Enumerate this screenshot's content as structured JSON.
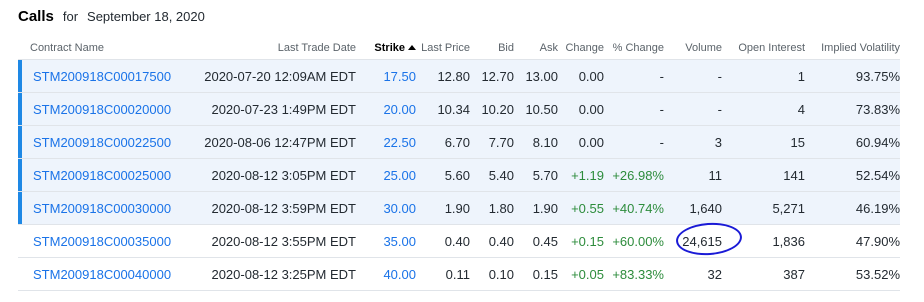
{
  "header": {
    "title": "Calls",
    "for_label": "for",
    "date": "September 18, 2020"
  },
  "columns": [
    "Contract Name",
    "Last Trade Date",
    "Strike",
    "Last Price",
    "Bid",
    "Ask",
    "Change",
    "% Change",
    "Volume",
    "Open Interest",
    "Implied Volatility"
  ],
  "sort": {
    "column": "Strike",
    "direction": "ascending"
  },
  "colors": {
    "link": "#1a73e8",
    "in_the_money_bg": "#eef4fc",
    "in_the_money_marker": "#1e88e5",
    "positive": "#2d8c3c",
    "annotation": "#1a1ad6"
  },
  "rows": [
    {
      "contract": "STM200918C00017500",
      "last_trade_date": "2020-07-20 12:09AM EDT",
      "strike": "17.50",
      "last_price": "12.80",
      "bid": "12.70",
      "ask": "13.00",
      "change": "0.00",
      "pct_change": "-",
      "volume": "-",
      "open_interest": "1",
      "implied_volatility": "93.75%",
      "in_the_money": true
    },
    {
      "contract": "STM200918C00020000",
      "last_trade_date": "2020-07-23 1:49PM EDT",
      "strike": "20.00",
      "last_price": "10.34",
      "bid": "10.20",
      "ask": "10.50",
      "change": "0.00",
      "pct_change": "-",
      "volume": "-",
      "open_interest": "4",
      "implied_volatility": "73.83%",
      "in_the_money": true
    },
    {
      "contract": "STM200918C00022500",
      "last_trade_date": "2020-08-06 12:47PM EDT",
      "strike": "22.50",
      "last_price": "6.70",
      "bid": "7.70",
      "ask": "8.10",
      "change": "0.00",
      "pct_change": "-",
      "volume": "3",
      "open_interest": "15",
      "implied_volatility": "60.94%",
      "in_the_money": true
    },
    {
      "contract": "STM200918C00025000",
      "last_trade_date": "2020-08-12 3:05PM EDT",
      "strike": "25.00",
      "last_price": "5.60",
      "bid": "5.40",
      "ask": "5.70",
      "change": "+1.19",
      "pct_change": "+26.98%",
      "volume": "11",
      "open_interest": "141",
      "implied_volatility": "52.54%",
      "in_the_money": true
    },
    {
      "contract": "STM200918C00030000",
      "last_trade_date": "2020-08-12 3:59PM EDT",
      "strike": "30.00",
      "last_price": "1.90",
      "bid": "1.80",
      "ask": "1.90",
      "change": "+0.55",
      "pct_change": "+40.74%",
      "volume": "1,640",
      "open_interest": "5,271",
      "implied_volatility": "46.19%",
      "in_the_money": true
    },
    {
      "contract": "STM200918C00035000",
      "last_trade_date": "2020-08-12 3:55PM EDT",
      "strike": "35.00",
      "last_price": "0.40",
      "bid": "0.40",
      "ask": "0.45",
      "change": "+0.15",
      "pct_change": "+60.00%",
      "volume": "24,615",
      "open_interest": "1,836",
      "implied_volatility": "47.90%",
      "in_the_money": false,
      "circled": "volume"
    },
    {
      "contract": "STM200918C00040000",
      "last_trade_date": "2020-08-12 3:25PM EDT",
      "strike": "40.00",
      "last_price": "0.11",
      "bid": "0.10",
      "ask": "0.15",
      "change": "+0.05",
      "pct_change": "+83.33%",
      "volume": "32",
      "open_interest": "387",
      "implied_volatility": "53.52%",
      "in_the_money": false
    }
  ]
}
